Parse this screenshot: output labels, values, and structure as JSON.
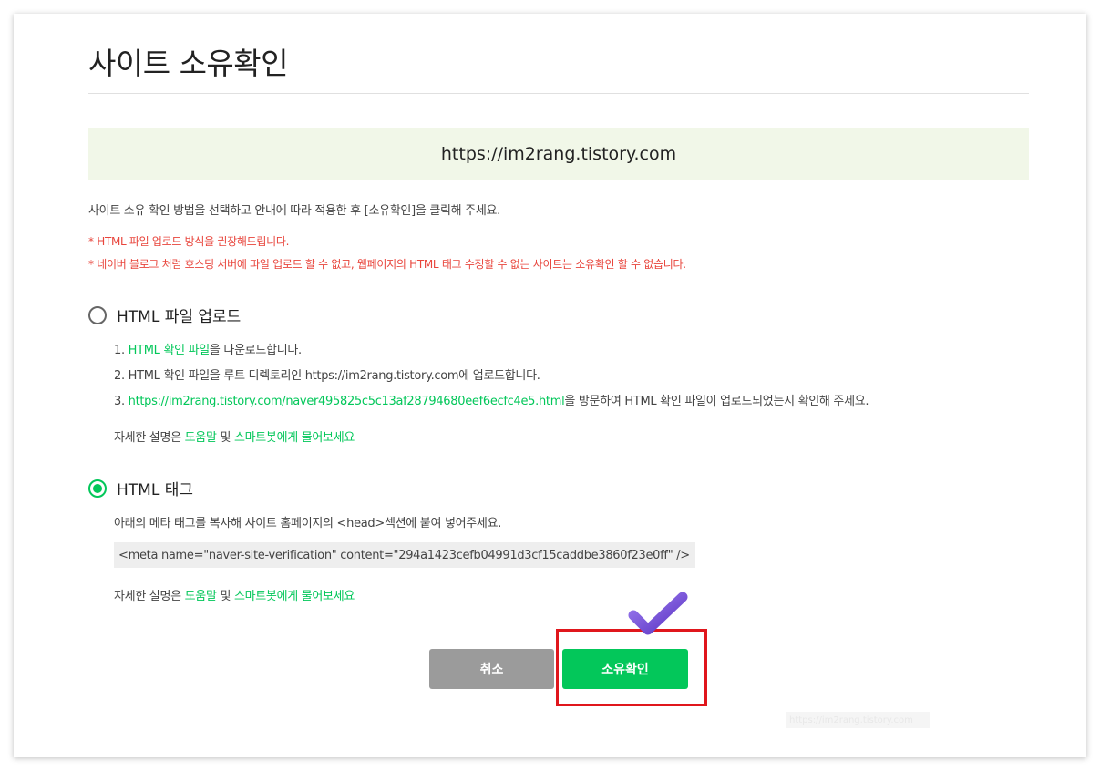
{
  "page": {
    "title": "사이트 소유확인",
    "site_url": "https://im2rang.tistory.com",
    "description": "사이트 소유 확인 방법을 선택하고 안내에 따라 적용한 후 [소유확인]을 클릭해 주세요.",
    "warnings": [
      "* HTML 파일 업로드 방식을 권장해드립니다.",
      "* 네이버 블로그 처럼 호스팅 서버에 파일 업로드 할 수 없고, 웹페이지의 HTML 태그 수정할 수 없는 사이트는 소유확인 할 수 없습니다."
    ]
  },
  "html_file": {
    "label": "HTML 파일 업로드",
    "selected": false,
    "step1_prefix": "1. ",
    "step1_link": "HTML 확인 파일",
    "step1_suffix": "을 다운로드합니다.",
    "step2": "2. HTML 확인 파일을 루트 디렉토리인 https://im2rang.tistory.com에 업로드합니다.",
    "step3_prefix": "3. ",
    "step3_link": "https://im2rang.tistory.com/naver495825c5c13af28794680eef6ecfc4e5.html",
    "step3_suffix": "을 방문하여 HTML 확인 파일이 업로드되었는지 확인해 주세요.",
    "help_prefix": "자세한 설명은 ",
    "help_link1": "도움말",
    "help_mid": " 및 ",
    "help_link2": "스마트봇에게 물어보세요"
  },
  "html_tag": {
    "label": "HTML 태그",
    "selected": true,
    "description": "아래의 메타 태그를 복사해 사이트 홈페이지의 <head>섹션에 붙여 넣어주세요.",
    "meta_code": "<meta name=\"naver-site-verification\" content=\"294a1423cefb04991d3cf15caddbe3860f23e0ff\" />",
    "help_prefix": "자세한 설명은 ",
    "help_link1": "도움말",
    "help_mid": " 및 ",
    "help_link2": "스마트봇에게 물어보세요"
  },
  "buttons": {
    "cancel": "취소",
    "confirm": "소유확인"
  },
  "watermark": "https://im2rang.tistory.com",
  "colors": {
    "accent_green": "#03c75a",
    "warning_red": "#e8453c",
    "highlight_red": "#e0161c",
    "url_box_bg": "#f1f7e8",
    "check_purple": "#7a4fd8"
  }
}
